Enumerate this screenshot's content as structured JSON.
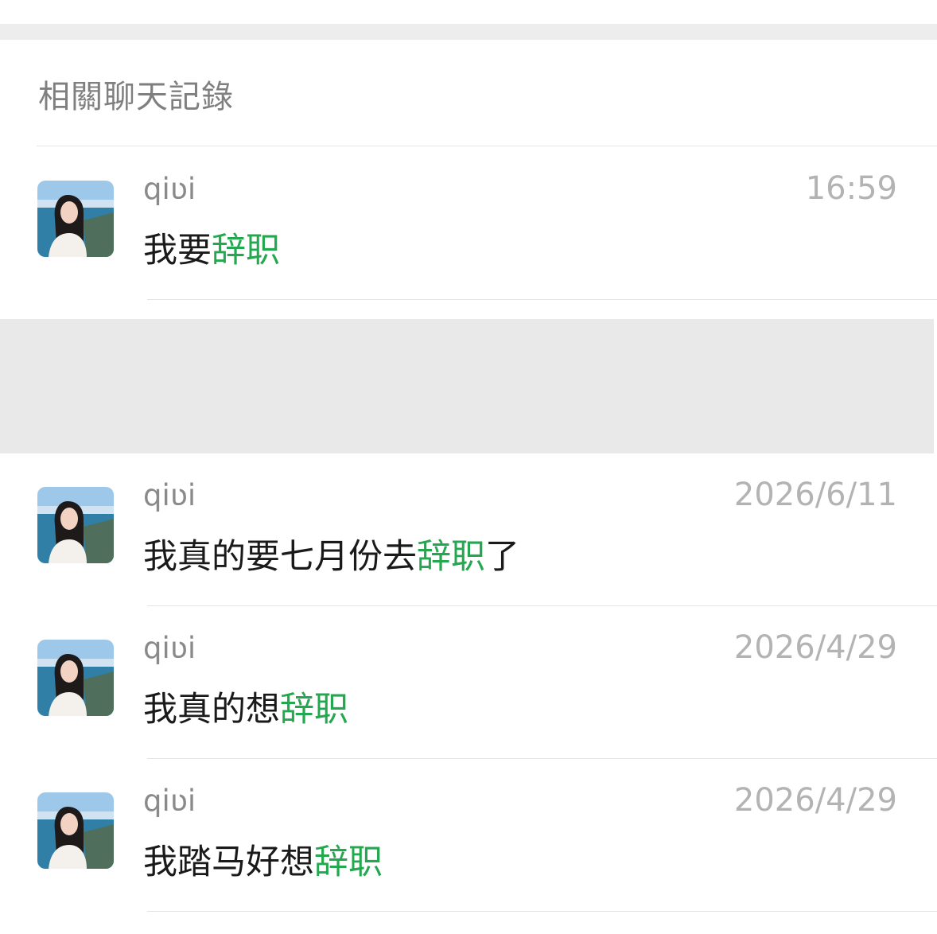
{
  "section": {
    "title": "相關聊天記錄"
  },
  "keyword_color": "#23a84f",
  "results": [
    {
      "sender": "qiʋi",
      "time": "16:59",
      "before": "我要",
      "keyword": "辞职",
      "after": ""
    },
    {
      "sender": "qiʋi",
      "time": "2026/6/11",
      "before": "我真的要七月份去",
      "keyword": "辞职",
      "after": "了"
    },
    {
      "sender": "qiʋi",
      "time": "2026/4/29",
      "before": "我真的想",
      "keyword": "辞职",
      "after": ""
    },
    {
      "sender": "qiʋi",
      "time": "2026/4/29",
      "before": "我踏马好想",
      "keyword": "辞职",
      "after": ""
    }
  ]
}
